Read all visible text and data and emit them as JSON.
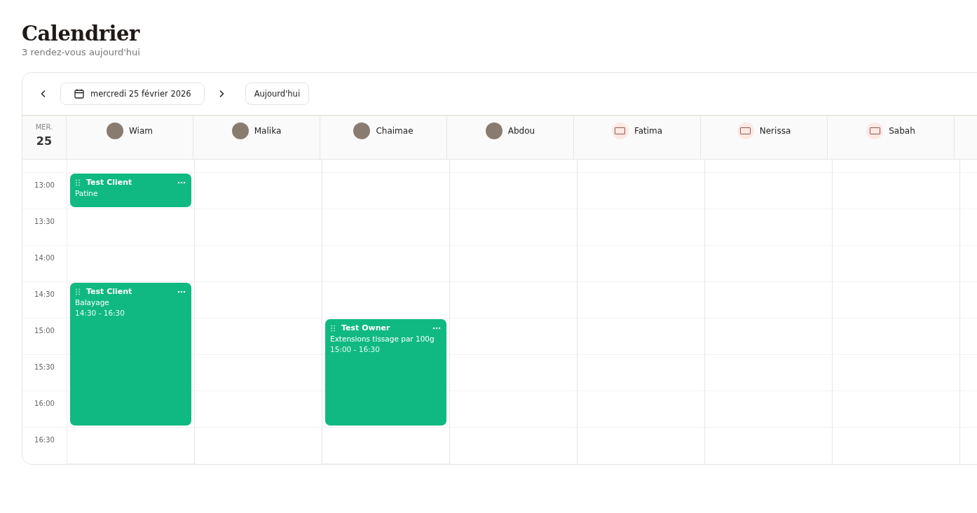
{
  "page": {
    "title": "Calendrier",
    "subtitle": "3 rendez-vous aujourd'hui"
  },
  "toolbar": {
    "date": "mercredi 25 février 2026",
    "today_button": "Aujourd'hui"
  },
  "day": {
    "weekday": "MER.",
    "number": "25"
  },
  "staff": [
    {
      "name": "Wiam",
      "kind": "photo",
      "slots": [
        {
          "kind": "appointment",
          "client": "Test Client",
          "service": "Patine"
        },
        {
          "kind": "free"
        },
        {
          "kind": "free"
        },
        {
          "kind": "appointment",
          "client": "Test Client",
          "service": "Balayage",
          "time": "14:30 - 16:30"
        },
        {
          "kind": "continued"
        },
        {
          "kind": "continued"
        },
        {
          "kind": "continued"
        },
        {
          "kind": "free"
        }
      ]
    },
    {
      "name": "Malika",
      "kind": "photo"
    },
    {
      "name": "Chaimae",
      "kind": "photo",
      "slots": [
        {
          "kind": "free"
        },
        {
          "kind": "free"
        },
        {
          "kind": "free"
        },
        {
          "kind": "free"
        },
        {
          "kind": "appointment",
          "client": "Test Owner",
          "service": "Extensions tissage par 100g",
          "time": "15:00 - 16:30"
        },
        {
          "kind": "continued"
        },
        {
          "kind": "continued"
        },
        {
          "kind": "free"
        }
      ]
    },
    {
      "name": "Abdou",
      "kind": "photo"
    },
    {
      "name": "Fatima",
      "kind": "logo"
    },
    {
      "name": "Nerissa",
      "kind": "logo"
    },
    {
      "name": "Sabah",
      "kind": "logo"
    }
  ],
  "times": [
    "13:00",
    "13:30",
    "14:00",
    "14:30",
    "15:00",
    "15:30",
    "16:00",
    "16:30"
  ]
}
